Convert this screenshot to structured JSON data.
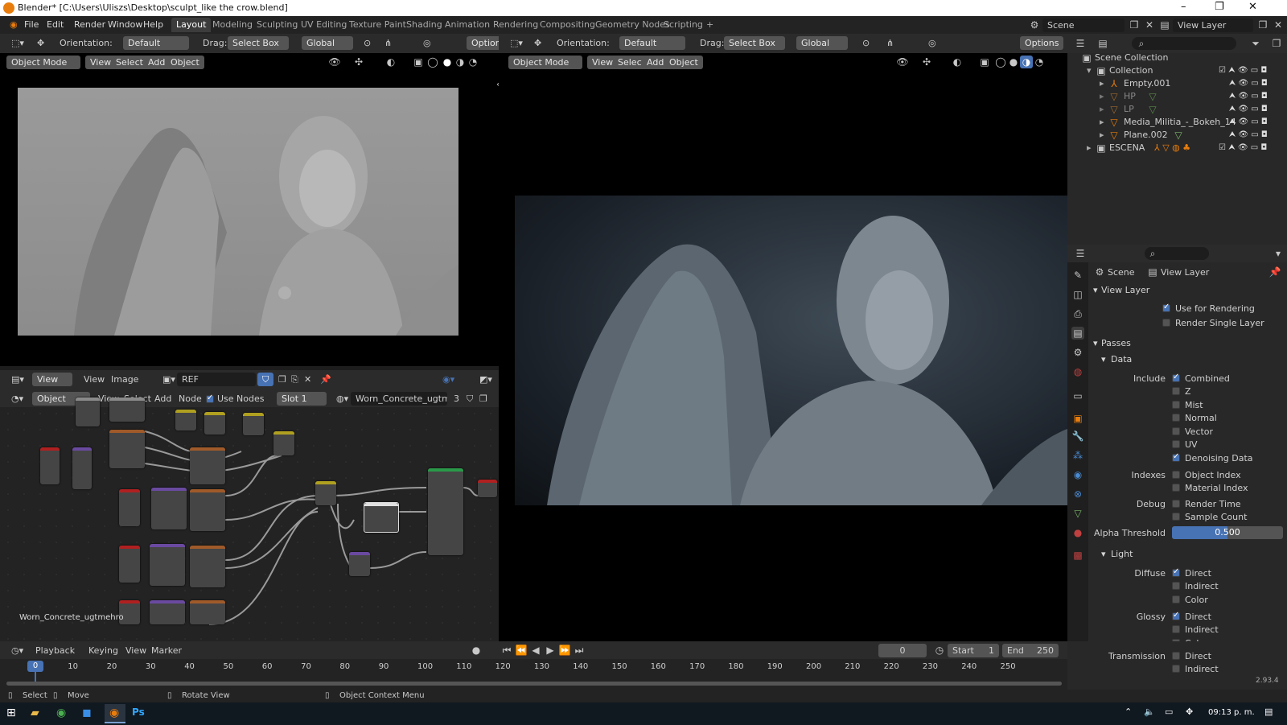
{
  "titlebar": {
    "title": "Blender* [C:\\Users\\Uliszs\\Desktop\\sculpt_like the crow.blend]",
    "min": "–",
    "max": "❐",
    "close": "✕"
  },
  "menus": [
    "File",
    "Edit",
    "Render",
    "Window",
    "Help"
  ],
  "workspaces": [
    "Layout",
    "Modeling",
    "Sculpting",
    "UV Editing",
    "Texture Paint",
    "Shading",
    "Animation",
    "Rendering",
    "Compositing",
    "Geometry Nodes",
    "Scripting"
  ],
  "workspace_add": "+",
  "scene": {
    "name": "Scene",
    "view_layer": "View Layer"
  },
  "tool_header": {
    "orientation_label": "Orientation:",
    "orientation": "Default",
    "drag_label": "Drag:",
    "drag": "Select Box",
    "transform": "Global",
    "options": "Options"
  },
  "viewport_header": {
    "mode": "Object Mode",
    "view": "View",
    "select": "Select",
    "add": "Add",
    "object": "Object"
  },
  "image_editor": {
    "view_mode": "View",
    "view": "View",
    "image": "Image",
    "image_name": "REF"
  },
  "node_editor": {
    "object": "Object",
    "view": "View",
    "select": "Select",
    "add": "Add",
    "node": "Node",
    "use_nodes": "Use Nodes",
    "slot": "Slot 1",
    "material": "Worn_Concrete_ugtmehro",
    "users": "3",
    "material_label": "Worn_Concrete_ugtmehro"
  },
  "outliner": {
    "scene_collection": "Scene Collection",
    "items": [
      {
        "name": "Collection",
        "level": 1
      },
      {
        "name": "Empty.001",
        "level": 2
      },
      {
        "name": "HP",
        "level": 2
      },
      {
        "name": "LP",
        "level": 2
      },
      {
        "name": "Media_Militia_-_Bokeh_14",
        "level": 2
      },
      {
        "name": "Plane.002",
        "level": 2
      },
      {
        "name": "ESCENA",
        "level": 1
      }
    ]
  },
  "properties": {
    "scene": "Scene",
    "view_layer": "View Layer",
    "sec_view_layer": "View Layer",
    "use_for_rendering": "Use for Rendering",
    "render_single_layer": "Render Single Layer",
    "sec_passes": "Passes",
    "sec_data": "Data",
    "include": "Include",
    "combined": "Combined",
    "z": "Z",
    "mist": "Mist",
    "normal": "Normal",
    "vector": "Vector",
    "uv": "UV",
    "denoising": "Denoising Data",
    "indexes": "Indexes",
    "object_index": "Object Index",
    "material_index": "Material Index",
    "debug": "Debug",
    "render_time": "Render Time",
    "sample_count": "Sample Count",
    "alpha_threshold": "Alpha Threshold",
    "alpha_value": "0.500",
    "alpha_fraction": 0.5,
    "sec_light": "Light",
    "diffuse": "Diffuse",
    "glossy": "Glossy",
    "transmission": "Transmission",
    "direct": "Direct",
    "indirect": "Indirect",
    "color": "Color"
  },
  "timeline": {
    "playback": "Playback",
    "keying": "Keying",
    "view": "View",
    "marker": "Marker",
    "current_frame": "0",
    "start_label": "Start",
    "start": "1",
    "end_label": "End",
    "end": "250",
    "marker_frame": "0",
    "ticks": [
      "10",
      "20",
      "30",
      "40",
      "50",
      "60",
      "70",
      "80",
      "90",
      "100",
      "110",
      "120",
      "130",
      "140",
      "150",
      "160",
      "170",
      "180",
      "190",
      "200",
      "210",
      "220",
      "230",
      "240",
      "250"
    ]
  },
  "statusbar": {
    "select": "Select",
    "move": "Move",
    "rotate": "Rotate View",
    "context": "Object Context Menu",
    "version": "2.93.4"
  },
  "taskbar": {
    "time": "09:13 p. m."
  },
  "colors": {
    "accent": "#4772b3",
    "orange": "#e87d0d",
    "green": "#7ab36a"
  }
}
